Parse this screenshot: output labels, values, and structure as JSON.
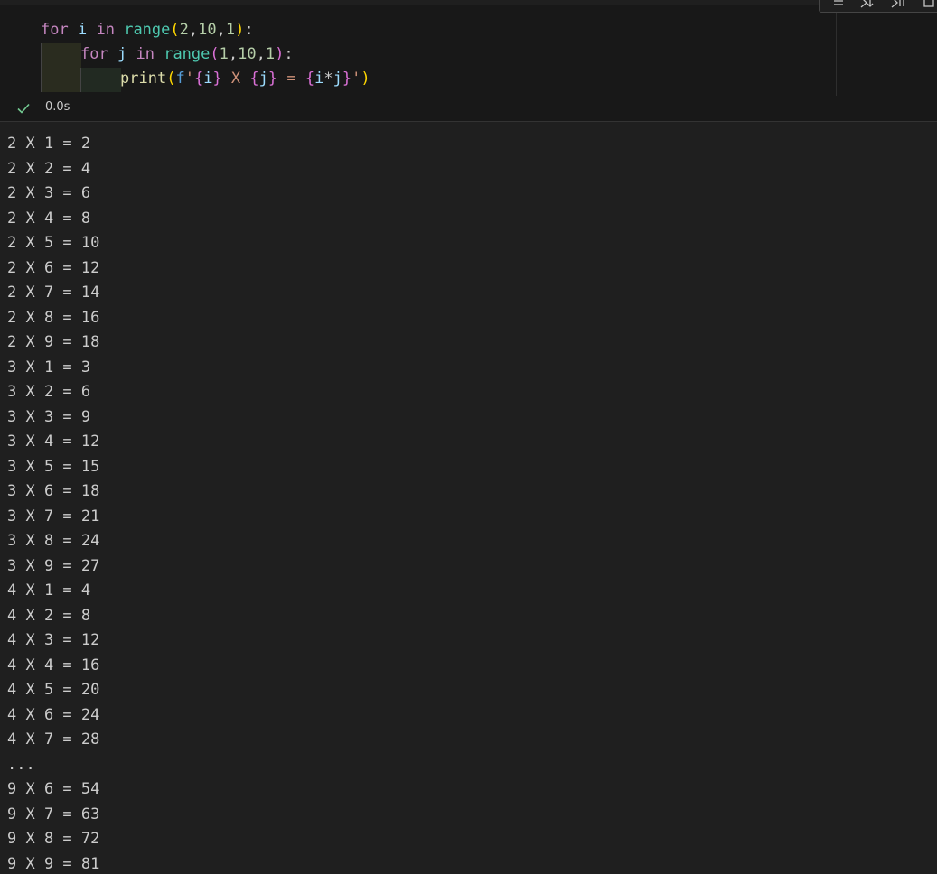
{
  "cell": {
    "code_lines": [
      {
        "parts": [
          {
            "t": "for",
            "c": "kw-for"
          },
          {
            "t": " ",
            "c": "punct"
          },
          {
            "t": "i",
            "c": "var"
          },
          {
            "t": " ",
            "c": "punct"
          },
          {
            "t": "in",
            "c": "kw-in"
          },
          {
            "t": " ",
            "c": "punct"
          },
          {
            "t": "range",
            "c": "fn"
          },
          {
            "t": "(",
            "c": "paren1"
          },
          {
            "t": "2",
            "c": "num"
          },
          {
            "t": ",",
            "c": "punct"
          },
          {
            "t": "10",
            "c": "num"
          },
          {
            "t": ",",
            "c": "punct"
          },
          {
            "t": "1",
            "c": "num"
          },
          {
            "t": ")",
            "c": "paren1"
          },
          {
            "t": ":",
            "c": "punct"
          }
        ]
      },
      {
        "parts": [
          {
            "t": "for",
            "c": "kw-for"
          },
          {
            "t": " ",
            "c": "punct"
          },
          {
            "t": "j",
            "c": "var"
          },
          {
            "t": " ",
            "c": "punct"
          },
          {
            "t": "in",
            "c": "kw-in"
          },
          {
            "t": " ",
            "c": "punct"
          },
          {
            "t": "range",
            "c": "fn"
          },
          {
            "t": "(",
            "c": "paren2"
          },
          {
            "t": "1",
            "c": "num"
          },
          {
            "t": ",",
            "c": "punct"
          },
          {
            "t": "10",
            "c": "num"
          },
          {
            "t": ",",
            "c": "punct"
          },
          {
            "t": "1",
            "c": "num"
          },
          {
            "t": ")",
            "c": "paren2"
          },
          {
            "t": ":",
            "c": "punct"
          }
        ]
      },
      {
        "parts": [
          {
            "t": "print",
            "c": "fn-print"
          },
          {
            "t": "(",
            "c": "paren1"
          },
          {
            "t": "f",
            "c": "fprefix"
          },
          {
            "t": "'",
            "c": "str"
          },
          {
            "t": "{",
            "c": "brace"
          },
          {
            "t": "i",
            "c": "var"
          },
          {
            "t": "}",
            "c": "brace"
          },
          {
            "t": " X ",
            "c": "str"
          },
          {
            "t": "{",
            "c": "brace"
          },
          {
            "t": "j",
            "c": "var"
          },
          {
            "t": "}",
            "c": "brace"
          },
          {
            "t": " = ",
            "c": "str"
          },
          {
            "t": "{",
            "c": "brace"
          },
          {
            "t": "i",
            "c": "var"
          },
          {
            "t": "*",
            "c": "punct"
          },
          {
            "t": "j",
            "c": "var"
          },
          {
            "t": "}",
            "c": "brace"
          },
          {
            "t": "'",
            "c": "str"
          },
          {
            "t": ")",
            "c": "paren1"
          }
        ]
      }
    ],
    "status_icon": "check-icon",
    "exec_time": "0.0s"
  },
  "toolbar": {
    "icons": [
      "split-icon",
      "run-below-icon",
      "run-above-icon",
      "more-icon"
    ]
  },
  "output_lines": [
    "2 X 1 = 2",
    "2 X 2 = 4",
    "2 X 3 = 6",
    "2 X 4 = 8",
    "2 X 5 = 10",
    "2 X 6 = 12",
    "2 X 7 = 14",
    "2 X 8 = 16",
    "2 X 9 = 18",
    "3 X 1 = 3",
    "3 X 2 = 6",
    "3 X 3 = 9",
    "3 X 4 = 12",
    "3 X 5 = 15",
    "3 X 6 = 18",
    "3 X 7 = 21",
    "3 X 8 = 24",
    "3 X 9 = 27",
    "4 X 1 = 4",
    "4 X 2 = 8",
    "4 X 3 = 12",
    "4 X 4 = 16",
    "4 X 5 = 20",
    "4 X 6 = 24",
    "4 X 7 = 28",
    "...",
    "9 X 6 = 54",
    "9 X 7 = 63",
    "9 X 8 = 72",
    "9 X 9 = 81"
  ],
  "colors": {
    "background": "#1f1f1f",
    "cell_background": "#181818",
    "success": "#73c991"
  }
}
